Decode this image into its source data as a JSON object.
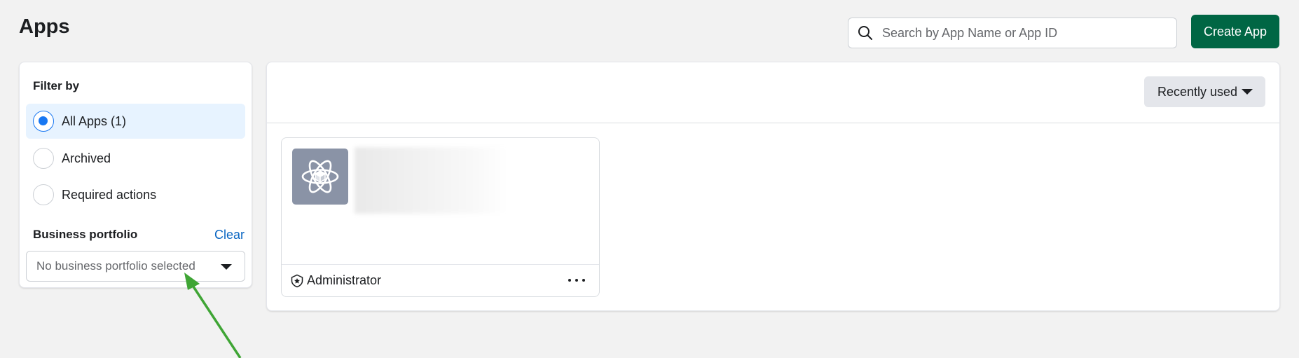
{
  "header": {
    "title": "Apps",
    "search_placeholder": "Search by App Name or App ID",
    "create_label": "Create App"
  },
  "filter": {
    "title": "Filter by",
    "options": [
      {
        "label": "All Apps (1)",
        "selected": true
      },
      {
        "label": "Archived",
        "selected": false
      },
      {
        "label": "Required actions",
        "selected": false
      }
    ],
    "business_portfolio": {
      "title": "Business portfolio",
      "clear_label": "Clear",
      "value": "No business portfolio selected"
    }
  },
  "main": {
    "sort_label": "Recently used",
    "apps": [
      {
        "role": "Administrator",
        "icon": "atom-icon"
      }
    ]
  },
  "colors": {
    "primary_button": "#006644",
    "link": "#0a66c2",
    "selected_bg": "#e7f3ff",
    "radio_active": "#1877f2",
    "annotation_arrow": "#3fa535"
  }
}
